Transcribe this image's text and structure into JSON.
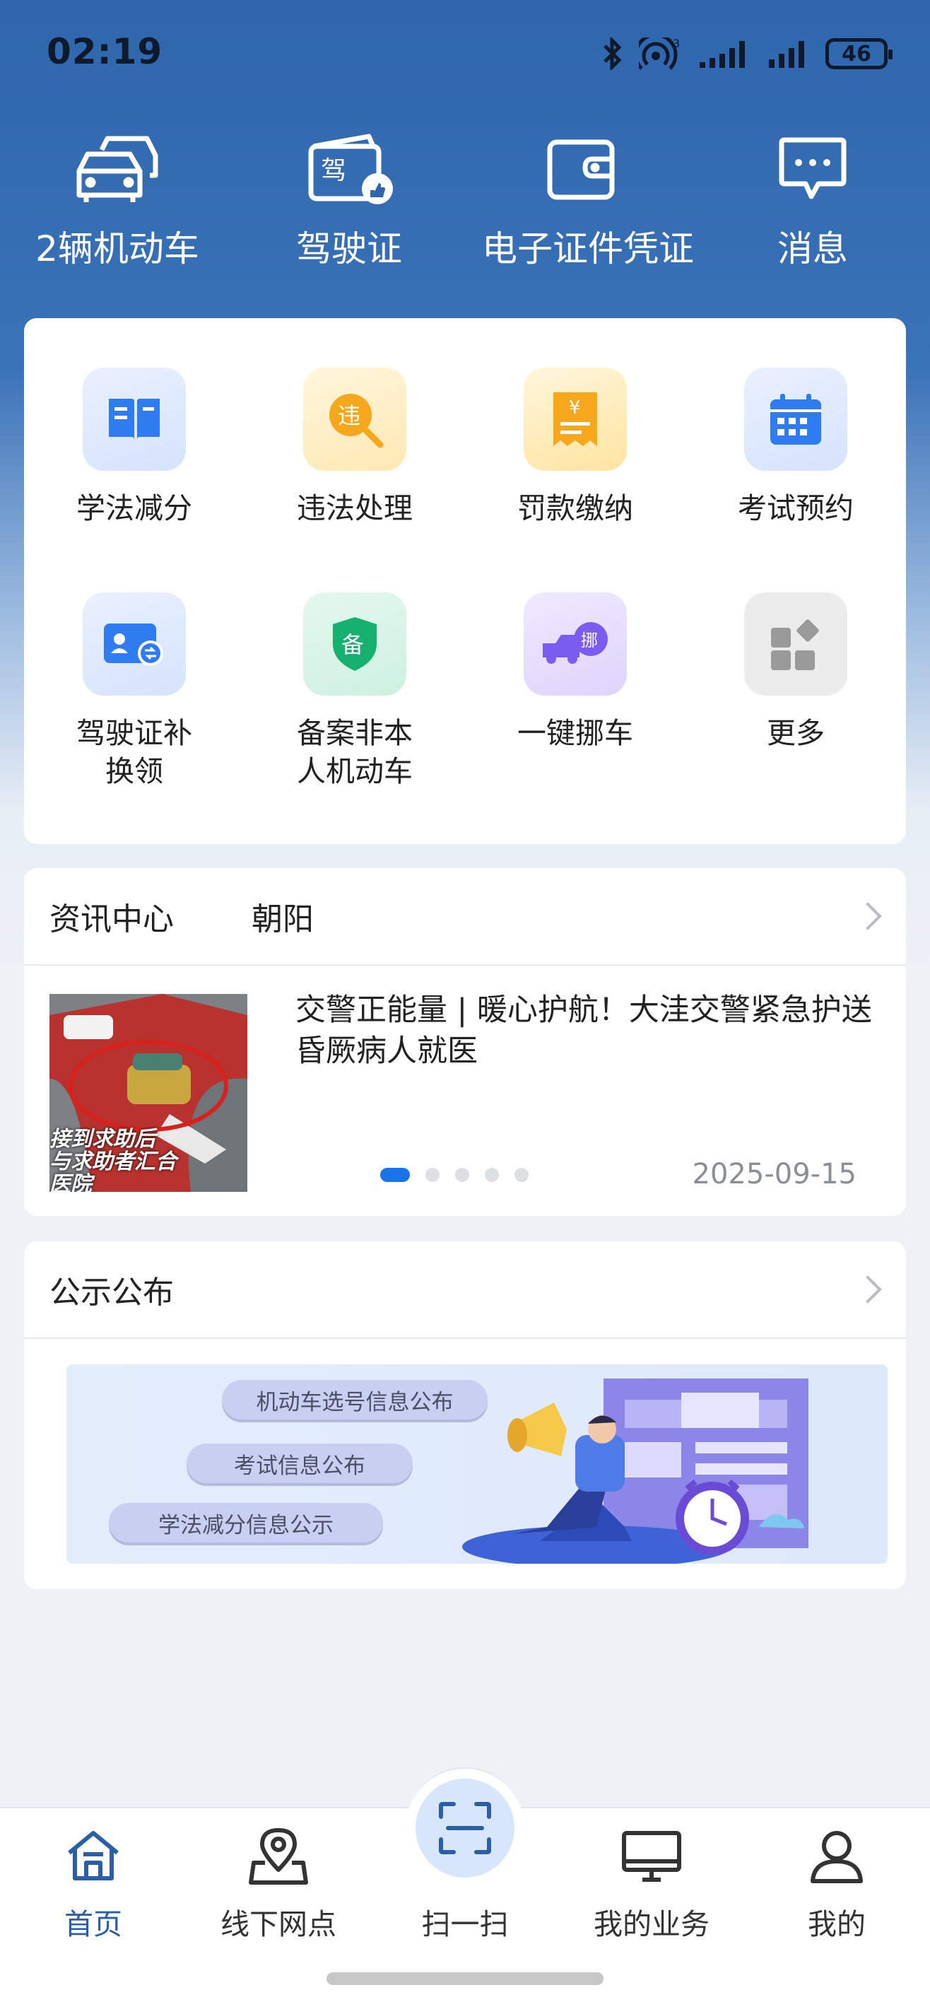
{
  "status_bar": {
    "time": "02:19",
    "battery": "46"
  },
  "quick_row": [
    {
      "label": "2辆机动车",
      "icon": "car-icon"
    },
    {
      "label": "驾驶证",
      "icon": "license-icon"
    },
    {
      "label": "电子证件凭证",
      "icon": "wallet-icon"
    },
    {
      "label": "消息",
      "icon": "message-icon"
    }
  ],
  "services": [
    {
      "label": "学法减分",
      "icon": "book-icon",
      "glyph": ""
    },
    {
      "label": "违法处理",
      "icon": "violation-search-icon",
      "glyph": "违"
    },
    {
      "label": "罚款缴纳",
      "icon": "fine-receipt-icon",
      "glyph": "¥"
    },
    {
      "label": "考试预约",
      "icon": "calendar-icon",
      "glyph": ""
    },
    {
      "label": "驾驶证补\n换领",
      "icon": "license-exchange-icon",
      "glyph": ""
    },
    {
      "label": "备案非本\n人机动车",
      "icon": "shield-record-icon",
      "glyph": "备"
    },
    {
      "label": "一键挪车",
      "icon": "move-truck-icon",
      "glyph": "挪"
    },
    {
      "label": "更多",
      "icon": "more-grid-icon",
      "glyph": ""
    }
  ],
  "news": {
    "tab_active": "资讯中心",
    "tab_city": "朝阳",
    "headline": "交警正能量 | 暖心护航！大洼交警紧急护送昏厥病人就医",
    "date": "2025-09-15",
    "thumb_caption": [
      "接到求助后",
      "与求助者汇合",
      "医院"
    ]
  },
  "notice": {
    "title": "公示公布",
    "pills": [
      "机动车选号信息公布",
      "考试信息公布",
      "学法减分信息公示"
    ]
  },
  "bottom_nav": [
    {
      "label": "首页",
      "icon": "home-icon",
      "active": true
    },
    {
      "label": "线下网点",
      "icon": "location-map-icon",
      "active": false
    },
    {
      "label": "扫一扫",
      "icon": "scan-icon",
      "active": false
    },
    {
      "label": "我的业务",
      "icon": "monitor-icon",
      "active": false
    },
    {
      "label": "我的",
      "icon": "user-icon",
      "active": false
    }
  ],
  "colors": {
    "primary": "#2f66ad",
    "accent": "#1a73e8"
  }
}
